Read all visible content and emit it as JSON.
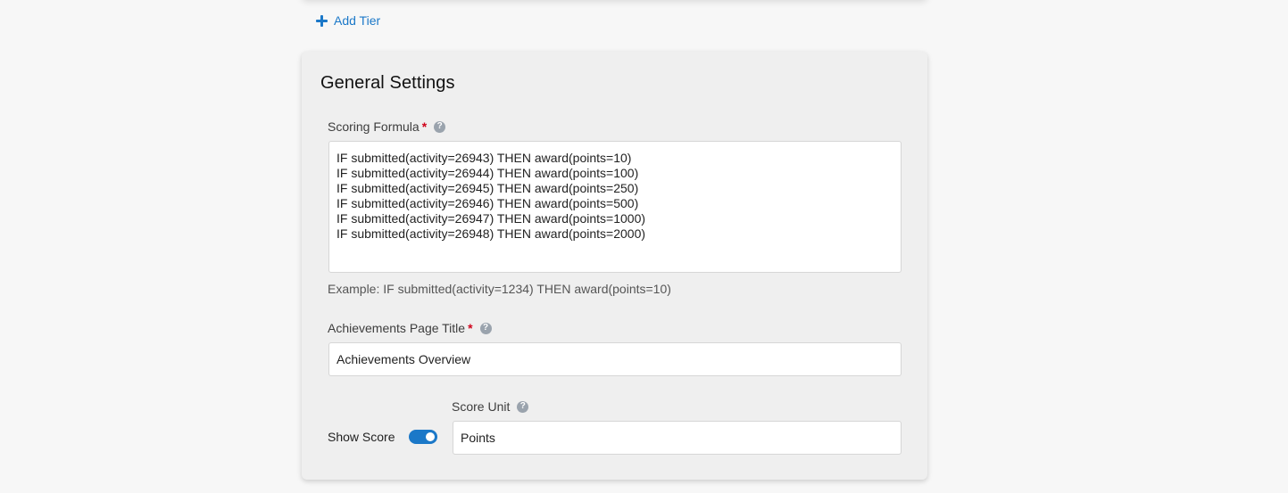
{
  "tiers": {
    "add_tier_label": "Add Tier"
  },
  "general_settings": {
    "title": "General Settings",
    "scoring_formula": {
      "label": "Scoring Formula",
      "required_mark": "*",
      "value": "IF submitted(activity=26943) THEN award(points=10)\nIF submitted(activity=26944) THEN award(points=100)\nIF submitted(activity=26945) THEN award(points=250)\nIF submitted(activity=26946) THEN award(points=500)\nIF submitted(activity=26947) THEN award(points=1000)\nIF submitted(activity=26948) THEN award(points=2000)",
      "hint": "Example: IF submitted(activity=1234) THEN award(points=10)"
    },
    "achievements_title": {
      "label": "Achievements Page Title",
      "required_mark": "*",
      "value": "Achievements Overview"
    },
    "show_score": {
      "label": "Show Score",
      "enabled": true
    },
    "score_unit": {
      "label": "Score Unit",
      "value": "Points"
    },
    "help_glyph": "?"
  },
  "colors": {
    "accent": "#1b78c8",
    "required": "#d0021b"
  },
  "icons": {
    "add": "plus-icon",
    "help": "help-icon"
  }
}
